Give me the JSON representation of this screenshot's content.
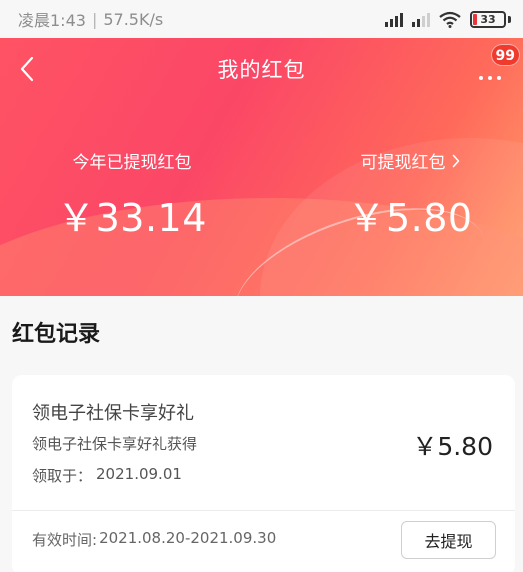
{
  "status_bar": {
    "time": "凌晨1:43",
    "separator": "|",
    "network_speed": "57.5K/s",
    "battery": "33"
  },
  "header": {
    "title": "我的红包",
    "badge_count": "99",
    "icons": {
      "back": "chevron-left-icon",
      "more": "more-dots-icon"
    },
    "colors": {
      "gradient_start": "#ff5364",
      "gradient_end": "#ffa06c"
    }
  },
  "balances": {
    "withdrawn_label": "今年已提现红包",
    "withdrawn_amount": "￥33.14",
    "available_label": "可提现红包",
    "available_amount": "￥5.80"
  },
  "records": {
    "section_title": "红包记录",
    "items": [
      {
        "name": "领电子社保卡享好礼",
        "description": "领电子社保卡享好礼获得",
        "date_label": "领取于：",
        "date": "2021.09.01",
        "amount": "￥5.80",
        "validity_label": "有效时间:",
        "validity": "2021.08.20-2021.09.30",
        "action_label": "去提现"
      }
    ]
  }
}
